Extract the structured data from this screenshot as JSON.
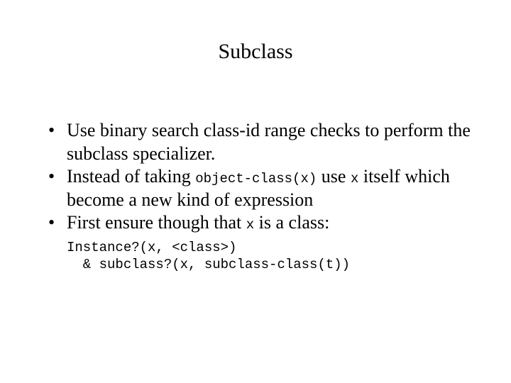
{
  "title": "Subclass",
  "bullets": {
    "b1": "Use binary search class-id range checks to perform the subclass specializer.",
    "b2_pre": "Instead of taking ",
    "b2_code1": "object-class(x)",
    "b2_mid": " use ",
    "b2_code2": "x",
    "b2_post": " itself which become a new kind of expression",
    "b3_pre": "First ensure though that ",
    "b3_code": "x",
    "b3_post": " is a class:"
  },
  "code": {
    "line1": "Instance?(x, <class>)",
    "line2": "  & subclass?(x, subclass-class(t))"
  }
}
